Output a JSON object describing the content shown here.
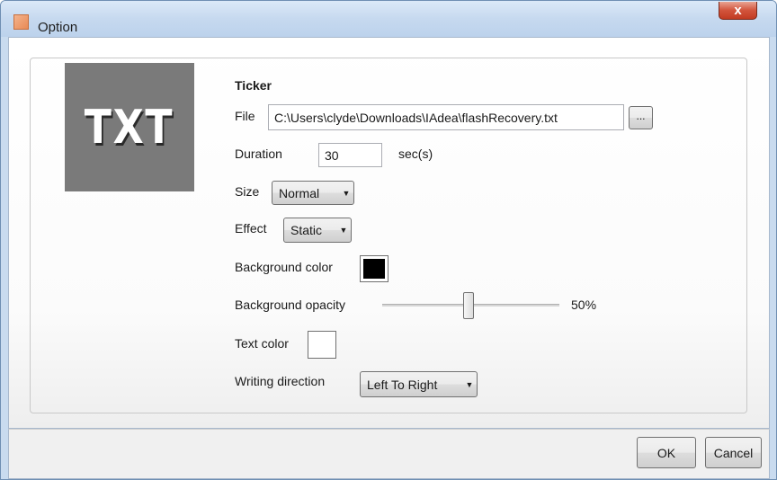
{
  "window": {
    "title": "Option",
    "close_label": "x",
    "app_icon": "app-icon"
  },
  "preview": {
    "image_text": "TXT",
    "background_color": "#7a7a7a"
  },
  "section": {
    "heading": "Ticker"
  },
  "file": {
    "label": "File",
    "value": "C:\\Users\\clyde\\Downloads\\IAdea\\flashRecovery.txt",
    "browse_label": "..."
  },
  "duration": {
    "label": "Duration",
    "value": "30",
    "unit": "sec(s)"
  },
  "size": {
    "label": "Size",
    "selected": "Normal"
  },
  "effect": {
    "label": "Effect",
    "selected": "Static"
  },
  "background_color": {
    "label": "Background color",
    "color": "#000000"
  },
  "background_opacity": {
    "label": "Background opacity",
    "value": 50,
    "display": "50%"
  },
  "text_color": {
    "label": "Text color",
    "color": "#ffffff"
  },
  "writing_direction": {
    "label": "Writing direction",
    "selected": "Left To Right"
  },
  "footer": {
    "ok_label": "OK",
    "cancel_label": "Cancel"
  }
}
